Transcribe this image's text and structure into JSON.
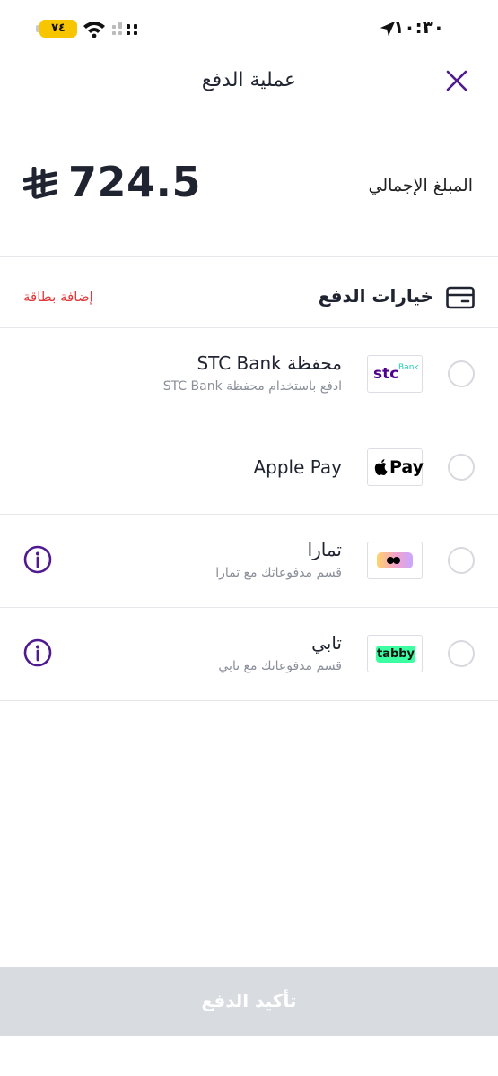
{
  "status_bar": {
    "time": "١٠:٣٠",
    "battery": "٧٤"
  },
  "header": {
    "title": "عملية الدفع"
  },
  "total": {
    "label": "المبلغ الإجمالي",
    "amount": "724.5"
  },
  "payment_options": {
    "title": "خيارات الدفع",
    "add_card": "إضافة بطاقة",
    "items": [
      {
        "name": "محفظة STC Bank",
        "subtitle": "ادفع باستخدام محفظة STC Bank",
        "logo_text": "stc",
        "logo_sup": "Bank"
      },
      {
        "name": "Apple Pay",
        "subtitle": "",
        "logo_text": "Pay"
      },
      {
        "name": "تمارا",
        "subtitle": "قسم مدفوعاتك مع تمارا"
      },
      {
        "name": "تابي",
        "subtitle": "قسم مدفوعاتك مع تابي",
        "logo_text": "tabby"
      }
    ]
  },
  "confirm": {
    "label": "تأكيد الدفع"
  },
  "colors": {
    "accent_purple": "#4f1a8f",
    "add_card_red": "#e5383b",
    "tabby_green": "#3bffa0",
    "stc_purple": "#4f008c",
    "stc_teal": "#1fcbb1",
    "battery_yellow": "#f7c600",
    "confirm_disabled": "#d8dbe0"
  }
}
